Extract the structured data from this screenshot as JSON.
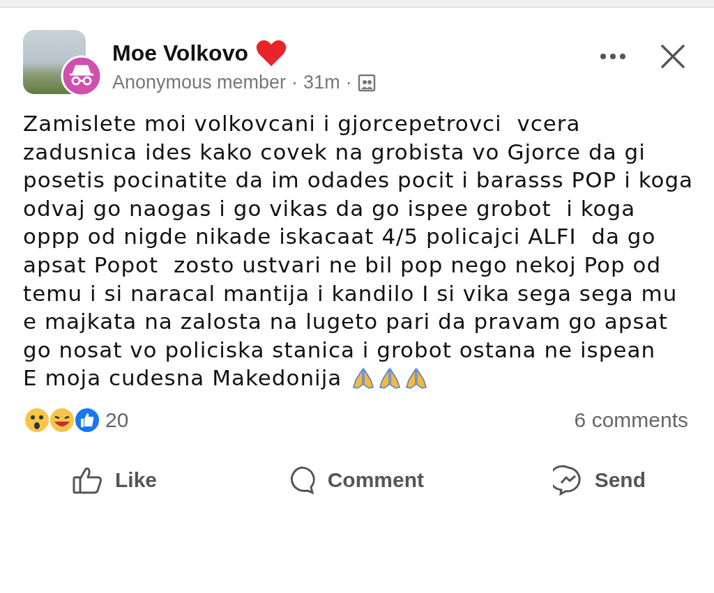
{
  "post": {
    "author": "Moe Volkovo",
    "member_label": "Anonymous member",
    "time": "31m",
    "separator": "·",
    "paragraphs": [
      "Zamislete moi volkovcani i gjorcepetrovci  vcera zadusnica ides kako covek na grobista vo Gjorce da gi posetis pocinatite da im odades pocit i barasss POP i koga odvaj go naogas i go vikas da go ispee grobot  i koga oppp od nigde nikade iskacaat 4/5 policajci ALFI  da go apsat Popot  zosto ustvari ne bil pop nego nekoj Pop od temu i si naracal mantija i kandilo I si vika sega sega mu e majkata na zalosta na lugeto pari da pravam go apsat go nosat vo policiska stanica i grobot ostana ne ispean",
      "E moja cudesna Makedonija"
    ],
    "reaction_count": "20",
    "comments": "6 comments"
  },
  "actions": [
    {
      "kind": "like",
      "label": "Like"
    },
    {
      "kind": "comment",
      "label": "Comment"
    },
    {
      "kind": "send",
      "label": "Send"
    }
  ]
}
